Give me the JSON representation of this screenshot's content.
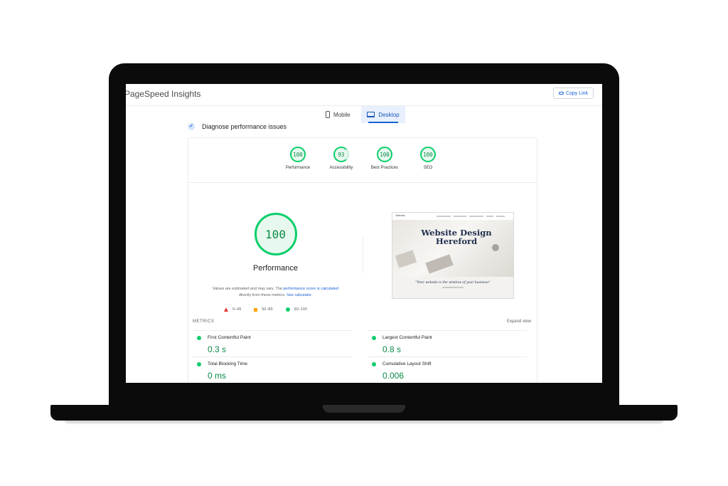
{
  "app": {
    "title": "PageSpeed Insights",
    "copy_link_label": "Copy Link"
  },
  "device_tabs": [
    {
      "label": "Mobile",
      "icon": "phone-icon",
      "selected": false
    },
    {
      "label": "Desktop",
      "icon": "laptop-icon",
      "selected": true
    }
  ],
  "diagnose": {
    "label": "Diagnose performance issues"
  },
  "scores": [
    {
      "label": "Performance",
      "value": "100"
    },
    {
      "label": "Accessibility",
      "value": "93"
    },
    {
      "label": "Best Practices",
      "value": "100"
    },
    {
      "label": "SEO",
      "value": "100"
    }
  ],
  "performance": {
    "score": "100",
    "title": "Performance",
    "note_prefix": "Values are estimated and may vary. The",
    "note_link1": "performance score is calculated",
    "note_middle": "directly from these metrics.",
    "note_link2": "See calculator."
  },
  "legend": [
    {
      "range": "0–49",
      "color": "#e53935",
      "shape": "triangle"
    },
    {
      "range": "50–89",
      "color": "#ffa400",
      "shape": "square"
    },
    {
      "range": "90–100",
      "color": "#0cce6b",
      "shape": "circle"
    }
  ],
  "thumbnail": {
    "logo": "Ochrona",
    "title": "Website Design Hereford",
    "tagline": "\"Your website is the window of your business\""
  },
  "metrics": {
    "heading": "METRICS",
    "expand_label": "Expand view",
    "items": [
      {
        "label": "First Contentful Paint",
        "value": "0.3 s"
      },
      {
        "label": "Largest Contentful Paint",
        "value": "0.8 s"
      },
      {
        "label": "Total Blocking Time",
        "value": "0 ms"
      },
      {
        "label": "Cumulative Layout Shift",
        "value": "0.006"
      }
    ]
  },
  "colors": {
    "good": "#0cce6b",
    "accent": "#1a62d3"
  }
}
